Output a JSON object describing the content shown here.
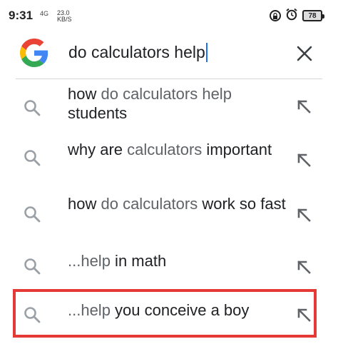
{
  "status_bar": {
    "time": "9:31",
    "network": "4G",
    "speed_value": "23.0",
    "speed_unit": "KB/S",
    "battery": "78"
  },
  "search": {
    "query": "do calculators help"
  },
  "suggestions": [
    {
      "parts": [
        {
          "t": "how ",
          "typed": false
        },
        {
          "t": "do calculators help",
          "typed": true
        },
        {
          "t": " students",
          "typed": false
        }
      ]
    },
    {
      "parts": [
        {
          "t": "why are ",
          "typed": false
        },
        {
          "t": "calculators",
          "typed": true
        },
        {
          "t": " important",
          "typed": false
        }
      ]
    },
    {
      "parts": [
        {
          "t": "how ",
          "typed": false
        },
        {
          "t": "do calculators",
          "typed": true
        },
        {
          "t": " work so fast",
          "typed": false
        }
      ]
    },
    {
      "parts": [
        {
          "t": "...help",
          "typed": true
        },
        {
          "t": " in math",
          "typed": false
        }
      ]
    },
    {
      "parts": [
        {
          "t": "...help",
          "typed": true
        },
        {
          "t": " you conceive a boy",
          "typed": false
        }
      ]
    }
  ],
  "colors": {
    "highlight": "#e53935",
    "caret": "#1a73e8",
    "typed_text": "#5f6368",
    "suggested_text": "#202124"
  }
}
